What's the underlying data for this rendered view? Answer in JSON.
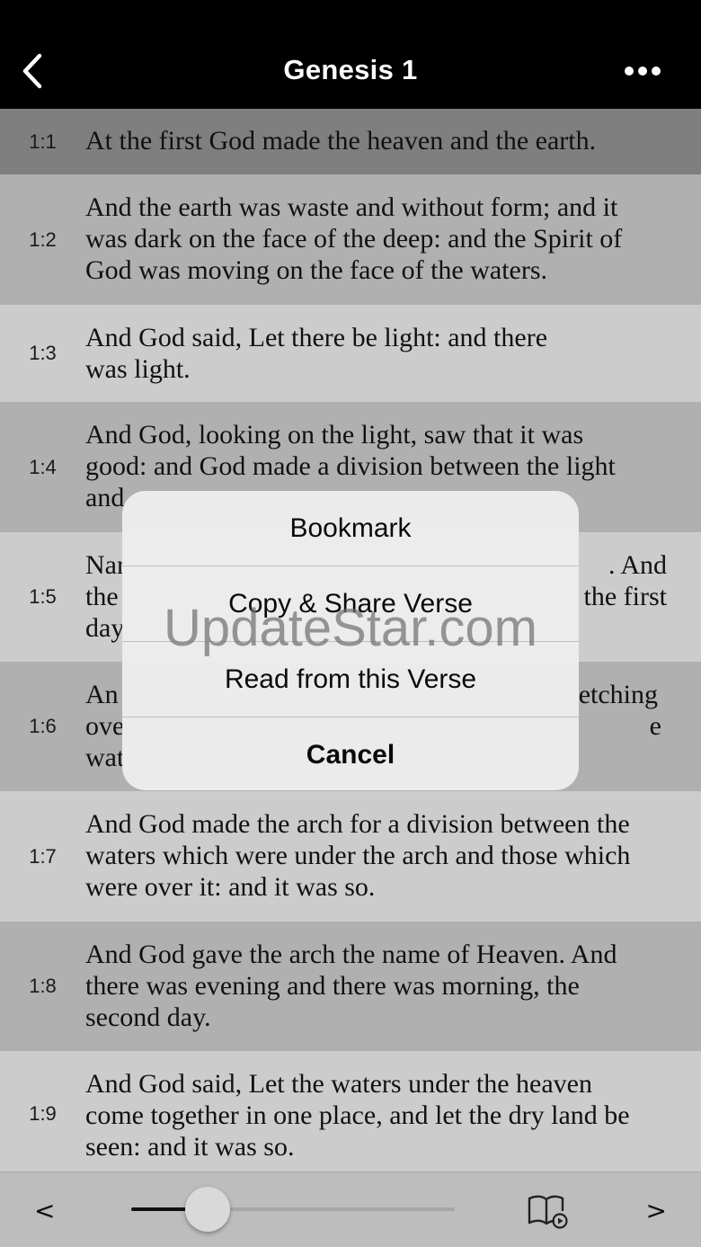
{
  "nav": {
    "title": "Genesis 1"
  },
  "verses": [
    {
      "num": "1:1",
      "lines": [
        "At the first God made the heaven and the earth."
      ]
    },
    {
      "num": "1:2",
      "lines": [
        "And the earth was waste and without form; and it",
        "was dark on the face of the deep: and the Spirit of",
        "God was moving on the face of the waters."
      ]
    },
    {
      "num": "1:3",
      "lines": [
        "And God said, Let there be light: and there",
        "was light."
      ]
    },
    {
      "num": "1:4",
      "lines": [
        "And God, looking on the light, saw that it was",
        "good: and God made a division between the light",
        "and"
      ]
    },
    {
      "num": "1:5",
      "lines": [
        "Nar",
        "the",
        "day"
      ],
      "right_lines": [
        ". And",
        "the first",
        ""
      ]
    },
    {
      "num": "1:6",
      "lines": [
        "An",
        "ove",
        "wat"
      ],
      "right_lines": [
        "etching",
        "e",
        ""
      ]
    },
    {
      "num": "1:7",
      "lines": [
        "And God made the arch for a division between the",
        "waters which were under the arch and those which",
        "were over it: and it was so."
      ]
    },
    {
      "num": "1:8",
      "lines": [
        "And God gave the arch the name of Heaven. And",
        "there was evening and there was morning, the",
        "second day."
      ]
    },
    {
      "num": "1:9",
      "lines": [
        "And God said, Let the waters under the heaven",
        "come together in one place, and let the dry land be",
        "seen: and it was so."
      ]
    }
  ],
  "sheet": {
    "items": [
      "Bookmark",
      "Copy & Share Verse",
      "Read from this Verse"
    ],
    "cancel": "Cancel"
  },
  "toolbar": {
    "prev": "<",
    "next": ">",
    "slider_position": 0.18
  },
  "watermark": "UpdateStar.com"
}
